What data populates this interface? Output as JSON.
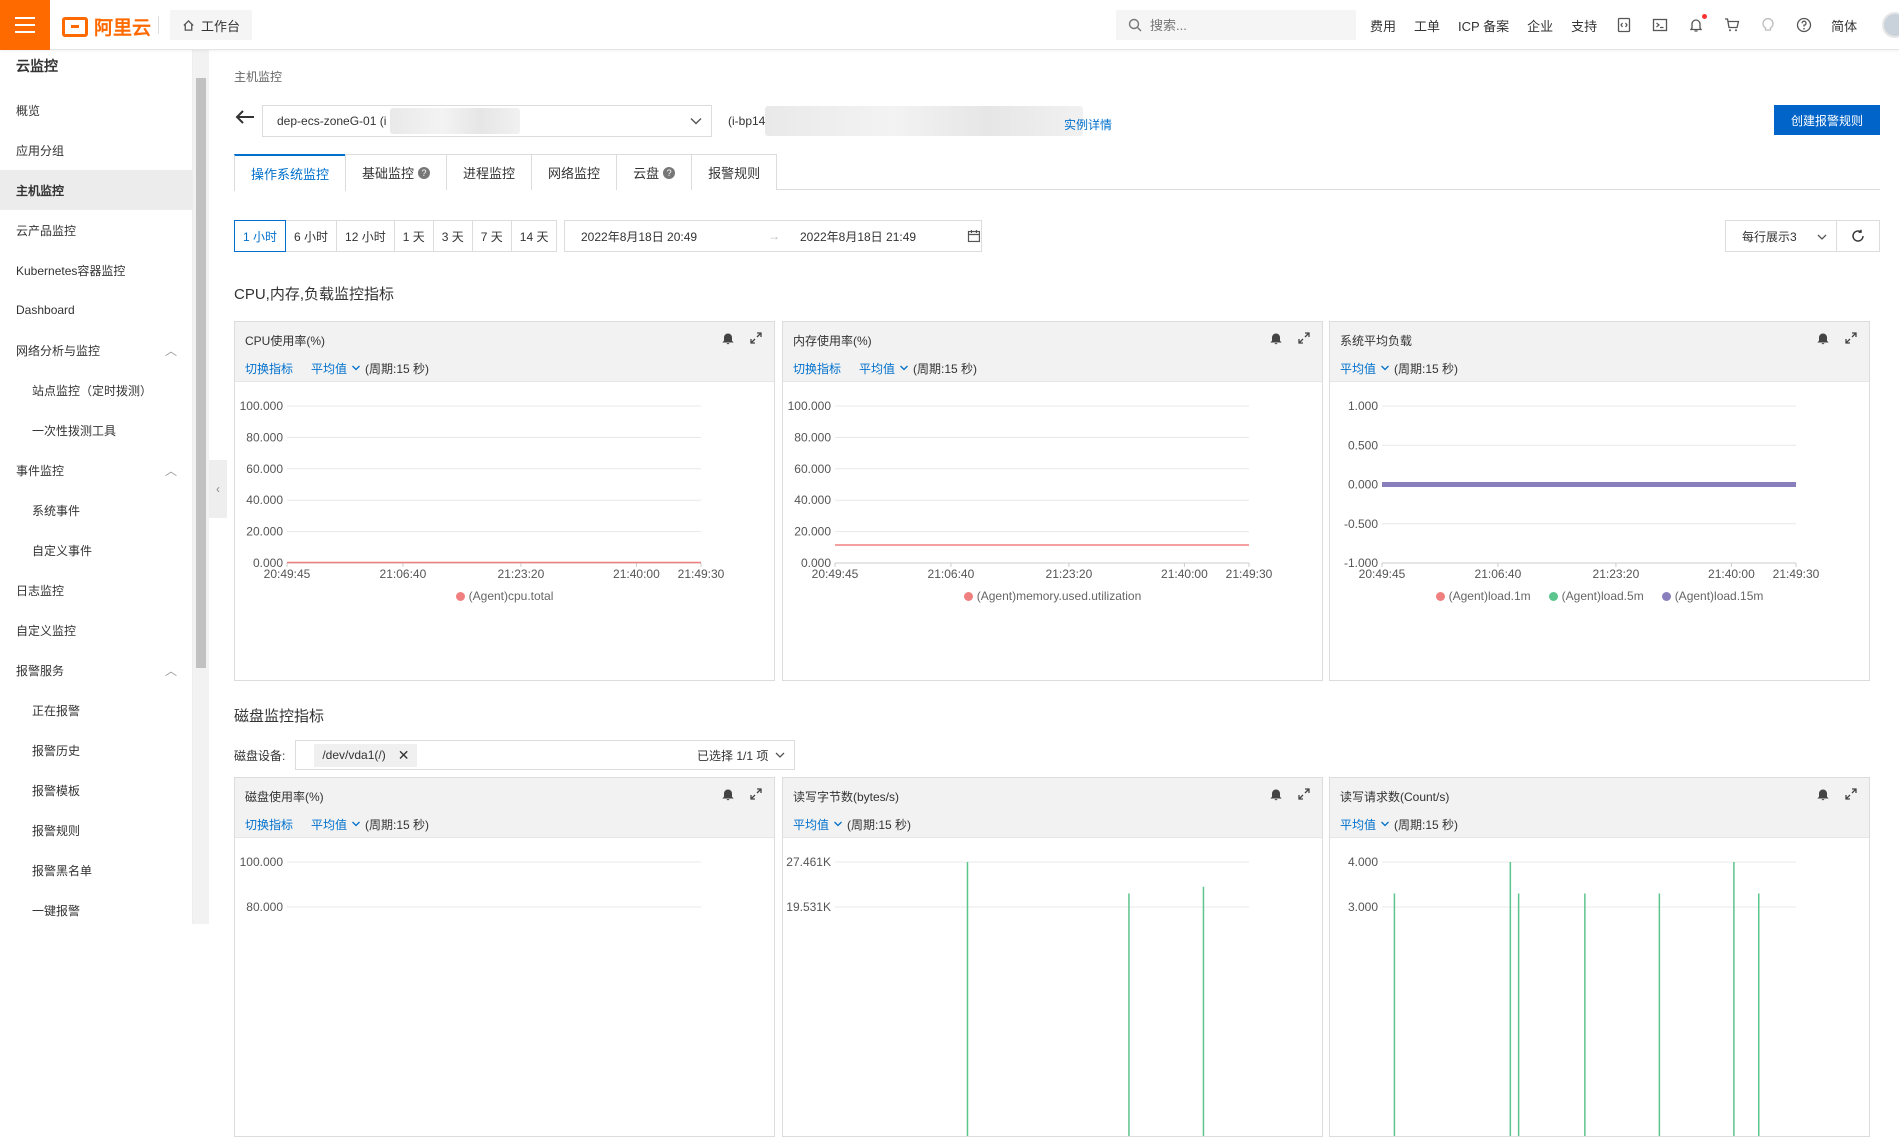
{
  "topbar": {
    "brand": "阿里云",
    "workbench": "工作台",
    "search_placeholder": "搜索...",
    "links": [
      "费用",
      "工单",
      "ICP 备案",
      "企业",
      "支持"
    ],
    "lang": "简体",
    "accent": "#ff6a00"
  },
  "sidebar": {
    "title": "云监控",
    "items": [
      {
        "label": "概览"
      },
      {
        "label": "应用分组"
      },
      {
        "label": "主机监控"
      },
      {
        "label": "云产品监控"
      },
      {
        "label": "Kubernetes容器监控"
      },
      {
        "label": "Dashboard"
      },
      {
        "label": "网络分析与监控"
      },
      {
        "label": "站点监控（定时拨测）"
      },
      {
        "label": "一次性拨测工具"
      },
      {
        "label": "事件监控"
      },
      {
        "label": "系统事件"
      },
      {
        "label": "自定义事件"
      },
      {
        "label": "日志监控"
      },
      {
        "label": "自定义监控"
      },
      {
        "label": "报警服务"
      },
      {
        "label": "正在报警"
      },
      {
        "label": "报警历史"
      },
      {
        "label": "报警模板"
      },
      {
        "label": "报警规则"
      },
      {
        "label": "报警黑名单"
      },
      {
        "label": "一键报警"
      }
    ],
    "active": "主机监控"
  },
  "main": {
    "breadcrumb": "主机监控",
    "instance_name": "dep-ecs-zoneG-01 (i",
    "instance_id": "(i-bp14",
    "instance_detail": "实例详情",
    "create_alarm": "创建报警规则",
    "tabs": [
      {
        "label": "操作系统监控",
        "help": false
      },
      {
        "label": "基础监控",
        "help": true
      },
      {
        "label": "进程监控",
        "help": false
      },
      {
        "label": "网络监控",
        "help": false
      },
      {
        "label": "云盘",
        "help": true
      },
      {
        "label": "报警规则",
        "help": false
      }
    ],
    "ranges": [
      "1 小时",
      "6 小时",
      "12 小时",
      "1 天",
      "3 天",
      "7 天",
      "14 天"
    ],
    "start_time": "2022年8月18日 20:49",
    "end_time": "2022年8月18日 21:49",
    "per_row": "每行展示3",
    "section1": "CPU,内存,负载监控指标",
    "section2": "磁盘监控指标",
    "disk_label": "磁盘设备:",
    "disk_tag": "/dev/vda1(/)",
    "disk_selected": "已选择 1/1 项",
    "switch_metric": "切换指标",
    "avg": "平均值",
    "period": "(周期:15 秒)"
  },
  "charts": [
    {
      "title": "CPU使用率(%)",
      "switch": true,
      "chart_data": {
        "type": "line",
        "title": "CPU使用率(%)",
        "x_ticks": [
          "20:49:45",
          "21:06:40",
          "21:23:20",
          "21:40:00",
          "21:49:30"
        ],
        "y_ticks": [
          "100.000",
          "80.000",
          "60.000",
          "40.000",
          "20.000",
          "0.000"
        ],
        "ylim": [
          0,
          100
        ],
        "series": [
          {
            "name": "(Agent)cpu.total",
            "color": "#f08080",
            "values": [
              0.3,
              0.3,
              0.3,
              0.3,
              0.3
            ]
          }
        ]
      }
    },
    {
      "title": "内存使用率(%)",
      "switch": true,
      "chart_data": {
        "type": "line",
        "title": "内存使用率(%)",
        "x_ticks": [
          "20:49:45",
          "21:06:40",
          "21:23:20",
          "21:40:00",
          "21:49:30"
        ],
        "y_ticks": [
          "100.000",
          "80.000",
          "60.000",
          "40.000",
          "20.000",
          "0.000"
        ],
        "ylim": [
          0,
          100
        ],
        "series": [
          {
            "name": "(Agent)memory.used.utilization",
            "color": "#f08080",
            "values": [
              11.5,
              11.5,
              11.5,
              11.5,
              11.5
            ]
          }
        ]
      }
    },
    {
      "title": "系统平均负载",
      "switch": false,
      "chart_data": {
        "type": "line",
        "title": "系统平均负载",
        "x_ticks": [
          "20:49:45",
          "21:06:40",
          "21:23:20",
          "21:40:00",
          "21:49:30"
        ],
        "y_ticks": [
          "1.000",
          "0.500",
          "0.000",
          "-0.500",
          "-1.000"
        ],
        "ylim": [
          -1,
          1
        ],
        "series": [
          {
            "name": "(Agent)load.1m",
            "color": "#f08080",
            "values": [
              0,
              0,
              0,
              0,
              0
            ]
          },
          {
            "name": "(Agent)load.5m",
            "color": "#5cc48d",
            "values": [
              0,
              0,
              0,
              0,
              0
            ]
          },
          {
            "name": "(Agent)load.15m",
            "color": "#8a7fbd",
            "values": [
              0,
              0,
              0,
              0,
              0
            ]
          }
        ]
      }
    },
    {
      "title": "磁盘使用率(%)",
      "switch": true,
      "chart_data": {
        "type": "line",
        "title": "磁盘使用率(%)",
        "y_ticks": [
          "100.000",
          "80.000"
        ],
        "ylim": [
          0,
          100
        ],
        "series": []
      }
    },
    {
      "title": "读写字节数(bytes/s)",
      "switch": false,
      "chart_data": {
        "type": "line",
        "title": "读写字节数(bytes/s)",
        "y_ticks": [
          "27.461K",
          "19.531K"
        ],
        "spikes": [
          0.32,
          0.71,
          0.89
        ],
        "spike_heights": [
          1.0,
          0.3,
          0.45
        ],
        "series": [
          {
            "name": "",
            "color": "#5cc48d"
          }
        ]
      }
    },
    {
      "title": "读写请求数(Count/s)",
      "switch": false,
      "chart_data": {
        "type": "line",
        "title": "读写请求数(Count/s)",
        "y_ticks": [
          "4.000",
          "3.000"
        ],
        "spikes": [
          0.03,
          0.31,
          0.33,
          0.49,
          0.67,
          0.85,
          0.91
        ],
        "spike_heights": [
          0.3,
          1.0,
          0.3,
          0.3,
          0.3,
          1.0,
          0.3
        ],
        "series": [
          {
            "name": "",
            "color": "#5cc48d"
          }
        ]
      }
    }
  ]
}
